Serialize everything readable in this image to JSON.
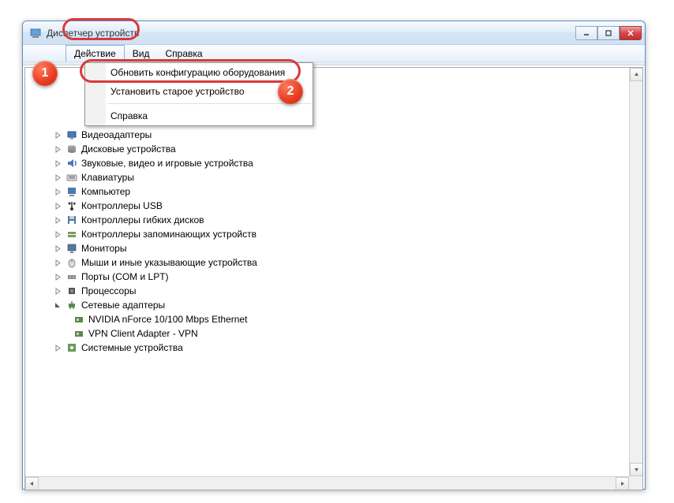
{
  "window": {
    "title": "Диспетчер устройств"
  },
  "menubar": {
    "action": "Действие",
    "view": "Вид",
    "help": "Справка"
  },
  "dropdown": {
    "update": "Обновить конфигурацию оборудования",
    "install": "Установить старое устройство",
    "help": "Справка"
  },
  "tree": {
    "items": [
      {
        "label": "Видеоадаптеры",
        "icon": "display"
      },
      {
        "label": "Дисковые устройства",
        "icon": "disk"
      },
      {
        "label": "Звуковые, видео и игровые устройства",
        "icon": "sound"
      },
      {
        "label": "Клавиатуры",
        "icon": "keyboard"
      },
      {
        "label": "Компьютер",
        "icon": "computer"
      },
      {
        "label": "Контроллеры USB",
        "icon": "usb"
      },
      {
        "label": "Контроллеры гибких дисков",
        "icon": "floppy"
      },
      {
        "label": "Контроллеры запоминающих устройств",
        "icon": "storage"
      },
      {
        "label": "Мониторы",
        "icon": "monitor"
      },
      {
        "label": "Мыши и иные указывающие устройства",
        "icon": "mouse"
      },
      {
        "label": "Порты (COM и LPT)",
        "icon": "port"
      },
      {
        "label": "Процессоры",
        "icon": "cpu"
      },
      {
        "label": "Сетевые адаптеры",
        "icon": "network",
        "expanded": true
      },
      {
        "label": "Системные устройства",
        "icon": "system"
      }
    ],
    "network_children": [
      "NVIDIA nForce 10/100 Mbps Ethernet",
      "VPN Client Adapter - VPN"
    ]
  },
  "badges": {
    "one": "1",
    "two": "2"
  }
}
